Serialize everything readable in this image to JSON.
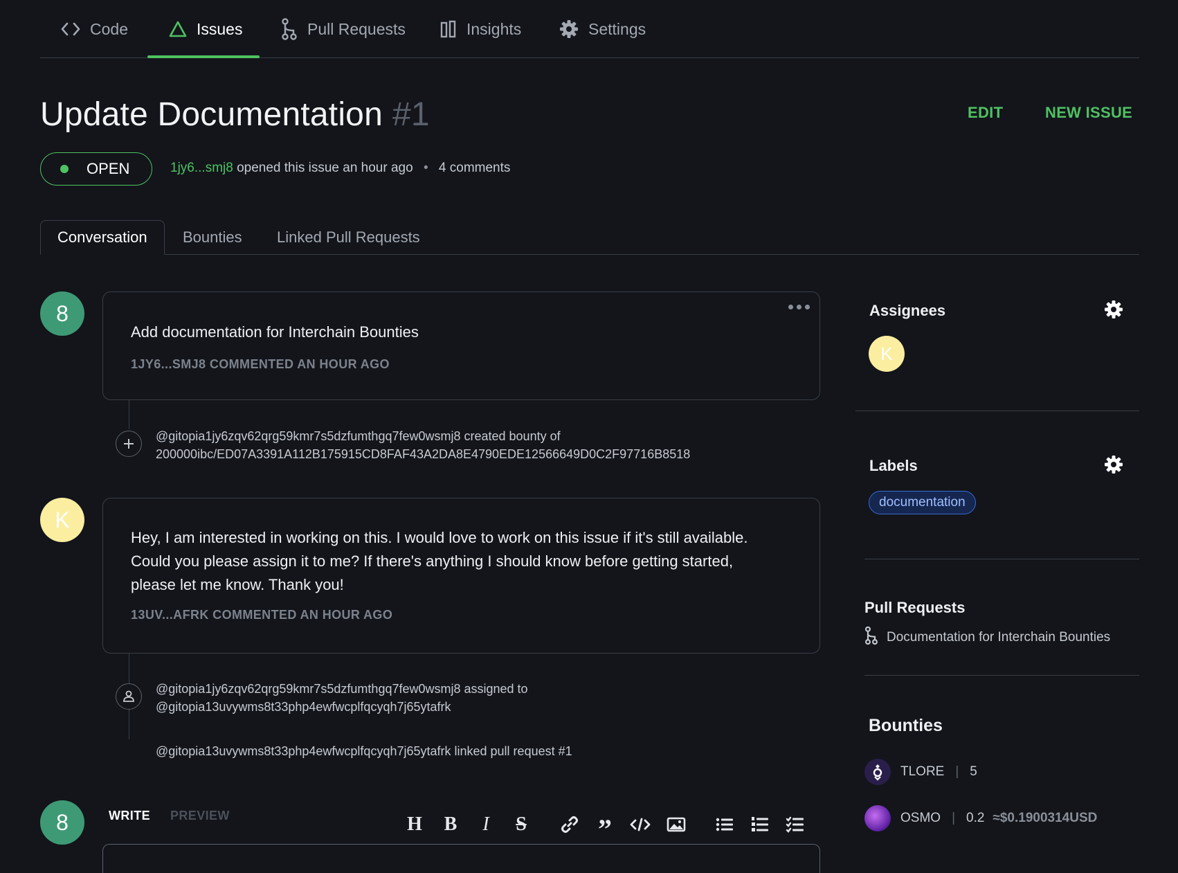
{
  "nav": {
    "items": [
      {
        "label": "Code",
        "icon": "code-icon"
      },
      {
        "label": "Issues",
        "icon": "issues-icon"
      },
      {
        "label": "Pull Requests",
        "icon": "pull-request-icon"
      },
      {
        "label": "Insights",
        "icon": "insights-icon"
      },
      {
        "label": "Settings",
        "icon": "gear-icon"
      }
    ],
    "active": "Issues"
  },
  "issue": {
    "title": "Update Documentation",
    "number": "#1",
    "status": "OPEN",
    "author": "1jy6...smj8",
    "opened_text": "opened this issue an hour ago",
    "separator": "•",
    "comments_count": "4 comments"
  },
  "actions": {
    "edit": "EDIT",
    "new_issue": "NEW ISSUE"
  },
  "tabs": [
    {
      "label": "Conversation",
      "active": true
    },
    {
      "label": "Bounties"
    },
    {
      "label": "Linked Pull Requests"
    }
  ],
  "timeline": {
    "comment1": {
      "avatar": "8",
      "body": "Add documentation for Interchain Bounties",
      "meta": "1JY6...SMJ8 COMMENTED AN HOUR AGO"
    },
    "event1": {
      "line1": "@gitopia1jy6zqv62qrg59kmr7s5dzfumthgq7few0wsmj8 created bounty of",
      "line2": "200000ibc/ED07A3391A112B175915CD8FAF43A2DA8E4790EDE12566649D0C2F97716B8518"
    },
    "comment2": {
      "avatar": "K",
      "body_lines": [
        "Hey, I am interested in working on this. I would love to work on this issue if it's still available.",
        "Could you please assign it to me? If there's anything I should know before getting started,",
        "please let me know. Thank you!"
      ],
      "meta": "13UV...AFRK COMMENTED AN HOUR AGO"
    },
    "event2": {
      "line1": "@gitopia1jy6zqv62qrg59kmr7s5dzfumthgq7few0wsmj8 assigned to",
      "line2": "@gitopia13uvywms8t33php4ewfwcplfqcyqh7j65ytafrk"
    },
    "event3": {
      "line1": "@gitopia13uvywms8t33php4ewfwcplfqcyqh7j65ytafrk linked pull request #1"
    }
  },
  "editor": {
    "avatar": "8",
    "write": "WRITE",
    "preview": "PREVIEW",
    "tools": [
      "heading-icon",
      "bold-icon",
      "italic-icon",
      "strikethrough-icon",
      "link-icon",
      "quote-icon",
      "code-icon",
      "image-icon",
      "bullet-list-icon",
      "numbered-list-icon",
      "task-list-icon"
    ]
  },
  "sidebar": {
    "assignees": {
      "title": "Assignees",
      "avatar": "K"
    },
    "labels": {
      "title": "Labels",
      "items": [
        "documentation"
      ]
    },
    "pull_requests": {
      "title": "Pull Requests",
      "items": [
        "Documentation for Interchain Bounties"
      ]
    },
    "bounties": {
      "title": "Bounties",
      "items": [
        {
          "denom": "TLORE",
          "sep": "|",
          "amount": "5",
          "usd": ""
        },
        {
          "denom": "OSMO",
          "sep": "|",
          "amount": "0.2",
          "usd": "≈$0.1900314USD"
        }
      ]
    }
  },
  "colors": {
    "background": "#13151b",
    "accent_green": "#4fc261",
    "avatar_green": "#3e9a75",
    "avatar_yellow": "#fbeea0",
    "label_blue": "#9ec0ff"
  }
}
